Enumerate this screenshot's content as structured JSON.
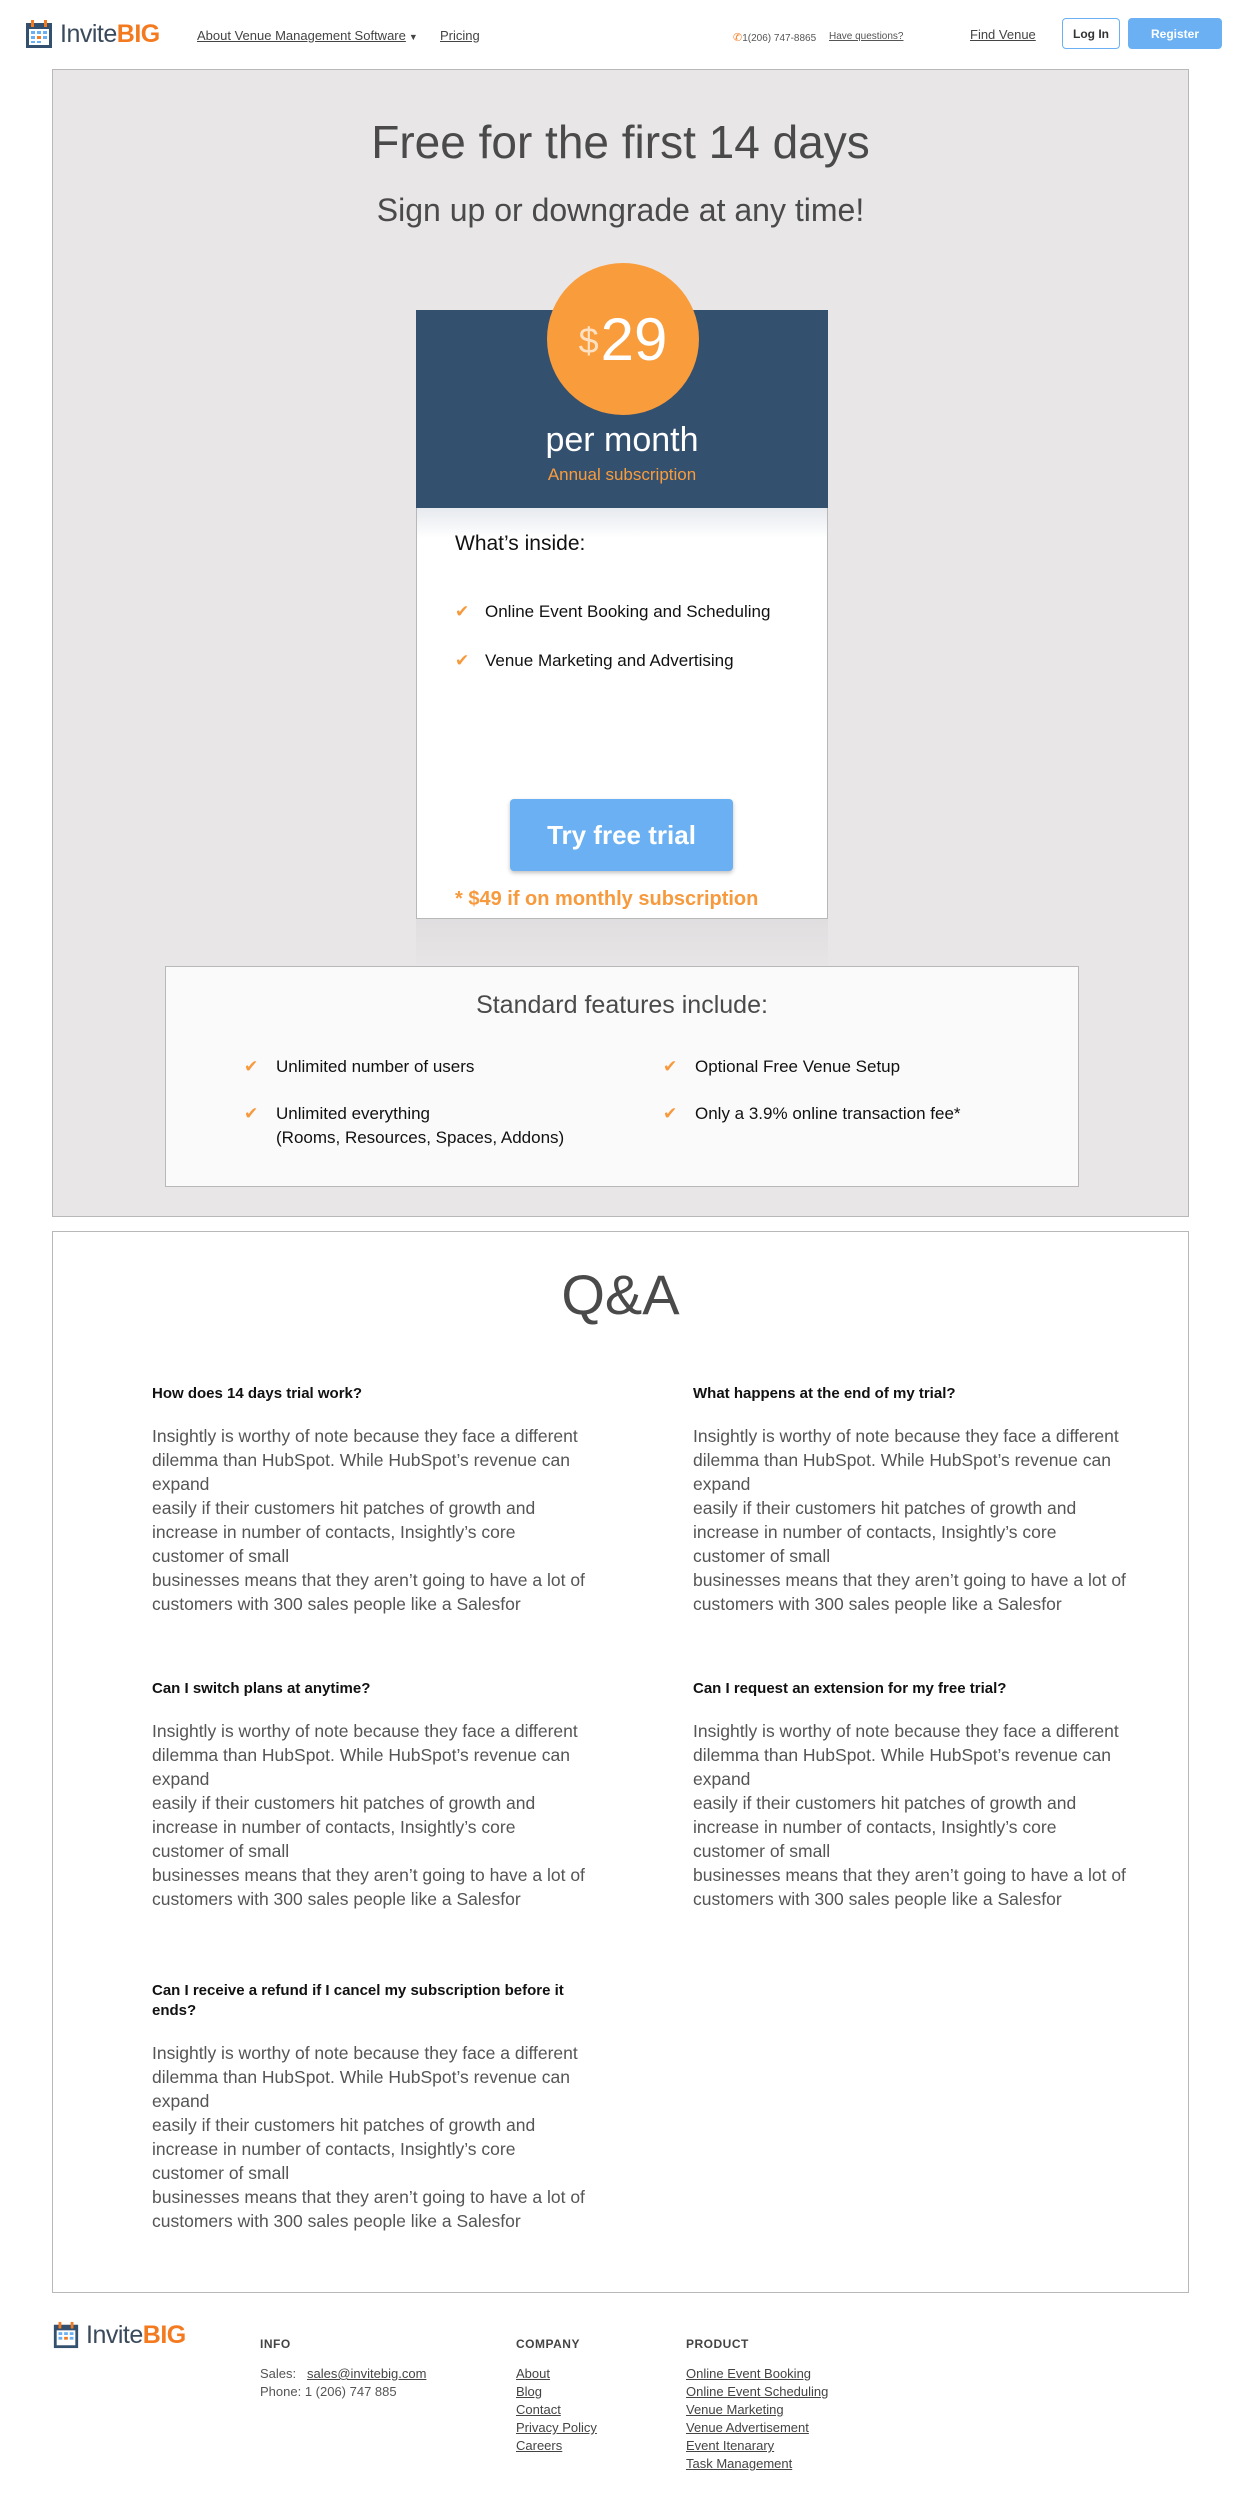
{
  "header": {
    "logo_part1": "Invite",
    "logo_part2": "BIG",
    "nav_about": "About Venue Management Software",
    "nav_pricing": "Pricing",
    "phone": "1(206) 747-8865",
    "have_questions": "Have questions?",
    "find_venue": "Find Venue",
    "login": "Log In",
    "register": "Register"
  },
  "pricing": {
    "title": "Free for the first 14 days",
    "subtitle": "Sign up or downgrade at any time!",
    "currency": "$",
    "amount": "29",
    "period": "per month",
    "billing": "Annual subscription",
    "inside_heading": "What’s inside:",
    "features": [
      "Online Event Booking and Scheduling",
      "Venue Marketing and Advertising"
    ],
    "trial_button": "Try free trial",
    "monthly_note": "* $49 if on monthly subscription"
  },
  "standard": {
    "title": "Standard features include:",
    "items": [
      "Unlimited number of users",
      "Unlimited everything",
      "(Rooms, Resources, Spaces, Addons)",
      "Optional Free Venue Setup",
      "Only a 3.9% online transaction fee*"
    ]
  },
  "qa": {
    "title": "Q&A",
    "questions": [
      {
        "q": "How does 14 days trial work?",
        "a": [
          "Insightly is worthy of note because they face a different dilemma than HubSpot. While HubSpot’s revenue can expand",
          "easily if their customers hit patches of growth and increase in number of contacts, Insightly’s core customer of small",
          "businesses means that they aren’t going to have a lot of customers with 300 sales people like a Salesfor"
        ]
      },
      {
        "q": "What happens at the end of my trial?",
        "a": [
          "Insightly is worthy of note because they face a different dilemma than HubSpot. While HubSpot’s revenue can expand",
          "easily if their customers hit patches of growth and increase in number of contacts, Insightly’s core customer of small",
          "businesses means that they aren’t going to have a lot of customers with 300 sales people like a Salesfor"
        ]
      },
      {
        "q": "Can I switch plans at anytime?",
        "a": [
          "Insightly is worthy of note because they face a different dilemma than HubSpot. While HubSpot’s revenue can expand",
          "easily if their customers hit patches of growth and increase in number of contacts, Insightly’s core customer of small",
          "businesses means that they aren’t going to have a lot of customers with 300 sales people like a Salesfor"
        ]
      },
      {
        "q": "Can I request an extension for my free trial?",
        "a": [
          "Insightly is worthy of note because they face a different dilemma than HubSpot. While HubSpot’s revenue can expand",
          "easily if their customers hit patches of growth and increase in number of contacts, Insightly’s core customer of small",
          "businesses means that they aren’t going to have a lot of customers with 300 sales people like a Salesfor"
        ]
      },
      {
        "q": "Can I receive a refund if I cancel my subscription before it ends?",
        "a": [
          "Insightly is worthy of note because they face a different dilemma than HubSpot. While HubSpot’s revenue can expand",
          "easily if their customers hit patches of growth and increase in number of contacts, Insightly’s core customer of small",
          "businesses means that they aren’t going to have a lot of customers with 300 sales people like a Salesfor"
        ]
      }
    ]
  },
  "footer": {
    "logo_part1": "Invite",
    "logo_part2": "BIG",
    "info_heading": "INFO",
    "sales_label": "Sales:",
    "sales_email": "sales@invitebig.com",
    "phone_line": "Phone: 1 (206) 747 885",
    "company_heading": "COMPANY",
    "company_links": [
      "About",
      "Blog",
      "Contact",
      "Privacy Policy",
      "Careers"
    ],
    "product_heading": "PRODUCT",
    "product_links": [
      "Online Event Booking",
      "Online Event Scheduling",
      "Venue Marketing",
      "Venue Advertisement",
      "Event Itenarary",
      "Task Management"
    ]
  },
  "colors": {
    "accent_orange": "#f79a3e",
    "brand_navy": "#34506f",
    "button_blue": "#6ab0f3"
  }
}
